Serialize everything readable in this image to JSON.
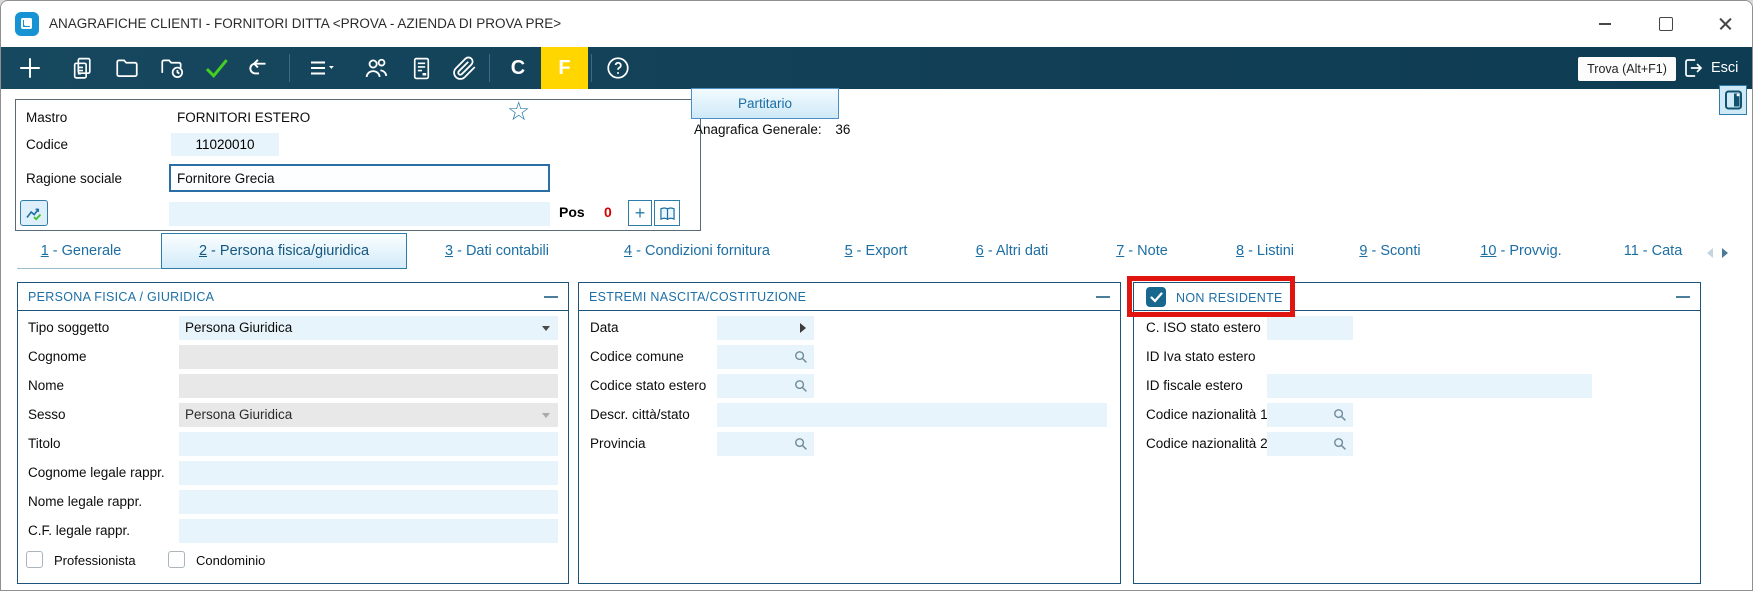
{
  "colors": {
    "toolbar_bg": "#14465e",
    "accent_blue": "#1c6ea4",
    "highlight_yellow": "#ffd600",
    "field_blue": "#e8f4fb",
    "disabled_gray": "#e8e8e8",
    "annotation_red": "#e01510",
    "pos_red": "#d40000",
    "panel_border": "#1b5478"
  },
  "window": {
    "title": "ANAGRAFICHE CLIENTI - FORNITORI DITTA <PROVA - AZIENDA DI PROVA PRE>"
  },
  "toolbar": {
    "letter_c": "C",
    "letter_f": "F",
    "find_label": "Trova (Alt+F1)",
    "exit_label": "Esci"
  },
  "header": {
    "mastro_label": "Mastro",
    "mastro_value": "FORNITORI ESTERO",
    "codice_label": "Codice",
    "codice_value": "11020010",
    "ragione_label": "Ragione sociale",
    "ragione_value": "Fornitore Grecia",
    "pos_label": "Pos",
    "pos_value": "0",
    "partitario_label": "Partitario",
    "anagrafica_label": "Anagrafica Generale:",
    "anagrafica_value": "36"
  },
  "tabs": [
    {
      "num": "1",
      "rest": " - Generale"
    },
    {
      "num": "2",
      "rest": " - Persona fisica/giuridica",
      "active": true
    },
    {
      "num": "3",
      "rest": " - Dati contabili"
    },
    {
      "num": "4",
      "rest": " - Condizioni fornitura"
    },
    {
      "num": "5",
      "rest": " - Export"
    },
    {
      "num": "6",
      "rest": " - Altri dati"
    },
    {
      "num": "7",
      "rest": " - Note"
    },
    {
      "num": "8",
      "rest": " - Listini"
    },
    {
      "num": "9",
      "rest": " - Sconti"
    },
    {
      "num": "10",
      "rest": " - Provvig."
    },
    {
      "num": "11",
      "rest": " - Cata"
    }
  ],
  "panels": {
    "persona": {
      "title": "PERSONA FISICA / GIURIDICA",
      "rows": [
        {
          "label": "Tipo soggetto",
          "value": "Persona Giuridica",
          "state": "dropdown"
        },
        {
          "label": "Cognome",
          "value": "",
          "state": "disabled"
        },
        {
          "label": "Nome",
          "value": "",
          "state": "disabled"
        },
        {
          "label": "Sesso",
          "value": "Persona Giuridica",
          "state": "disabled-dropdown"
        },
        {
          "label": "Titolo",
          "value": "",
          "state": "editable"
        },
        {
          "label": "Cognome legale rappr.",
          "value": "",
          "state": "editable"
        },
        {
          "label": "Nome legale rappr.",
          "value": "",
          "state": "editable"
        },
        {
          "label": "C.F. legale rappr.",
          "value": "",
          "state": "editable"
        }
      ],
      "checkboxes": [
        {
          "label": "Professionista",
          "checked": false
        },
        {
          "label": "Condominio",
          "checked": false
        }
      ]
    },
    "estremi": {
      "title": "ESTREMI NASCITA/COSTITUZIONE",
      "rows": [
        {
          "label": "Data",
          "value": "",
          "state": "date"
        },
        {
          "label": "Codice comune",
          "value": "",
          "state": "lookup"
        },
        {
          "label": "Codice stato estero",
          "value": "",
          "state": "lookup"
        },
        {
          "label": "Descr. città/stato",
          "value": "",
          "state": "wide"
        },
        {
          "label": "Provincia",
          "value": "",
          "state": "lookup"
        }
      ]
    },
    "non_residente": {
      "title": "NON RESIDENTE",
      "checked": true,
      "rows": [
        {
          "label": "C. ISO stato estero",
          "value": "",
          "state": "small"
        },
        {
          "label": "ID Iva stato estero",
          "value": "",
          "state": "plain"
        },
        {
          "label": "ID fiscale estero",
          "value": "",
          "state": "wide"
        },
        {
          "label": "Codice nazionalità 1",
          "value": "",
          "state": "lookup"
        },
        {
          "label": "Codice nazionalità 2",
          "value": "",
          "state": "lookup"
        }
      ]
    }
  }
}
